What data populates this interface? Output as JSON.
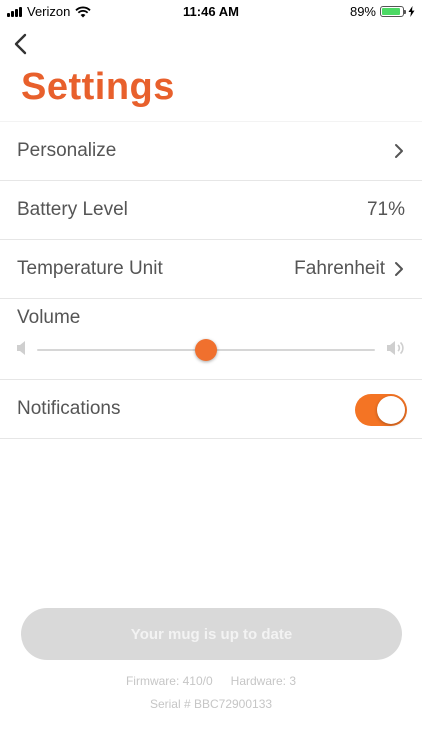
{
  "status_bar": {
    "carrier": "Verizon",
    "time": "11:46 AM",
    "battery_percent": "89%",
    "battery_level": 0.89,
    "icons": [
      "signal-bars-icon",
      "wifi-icon",
      "battery-icon",
      "charging-bolt-icon"
    ]
  },
  "header": {
    "back_icon": "chevron-left-icon",
    "title": "Settings",
    "title_color": "#e8602c"
  },
  "settings": {
    "personalize": {
      "label": "Personalize"
    },
    "battery": {
      "label": "Battery Level",
      "value": "71%"
    },
    "temperature": {
      "label": "Temperature Unit",
      "value": "Fahrenheit"
    },
    "volume": {
      "label": "Volume",
      "level": 0.5,
      "low_icon": "speaker-low-icon",
      "high_icon": "speaker-high-icon"
    },
    "notifications": {
      "label": "Notifications",
      "enabled": true
    }
  },
  "footer": {
    "update_button": "Your mug is up to date",
    "firmware": "Firmware: 410/0",
    "hardware": "Hardware: 3",
    "serial": "Serial # BBC72900133"
  },
  "colors": {
    "accent": "#f47424",
    "slider_thumb": "#f0702e",
    "disabled_button": "#d9d9d9"
  }
}
